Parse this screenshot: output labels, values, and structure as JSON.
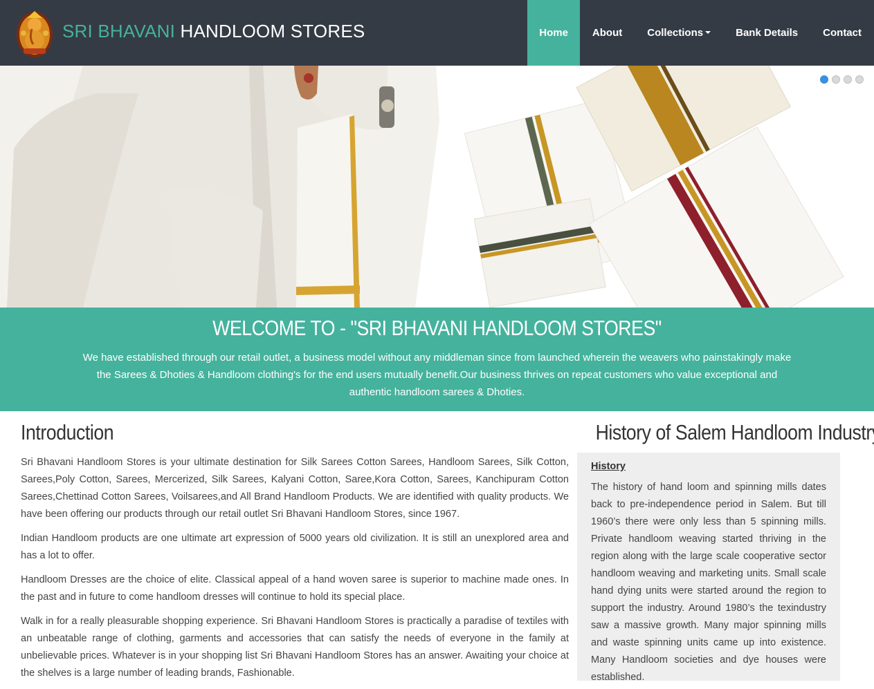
{
  "brand": {
    "part1": "SRI BHAVANI",
    "part2": "HANDLOOM STORES"
  },
  "nav": {
    "home": "Home",
    "about": "About",
    "collections": "Collections",
    "bank": "Bank Details",
    "contact": "Contact"
  },
  "colors": {
    "navbar_bg": "#353b45",
    "accent": "#45b29d",
    "active_dot": "#3a8fe0"
  },
  "carousel": {
    "slide_count": 4,
    "active_index": 0
  },
  "welcome": {
    "title": "WELCOME TO - \"SRI BHAVANI HANDLOOM STORES\"",
    "text": "We have established through our retail outlet, a business model without any middleman since from launched wherein the weavers who painstakingly make the Sarees & Dhoties & Handloom clothing's for the end users mutually benefit.Our business thrives on repeat customers who value exceptional and authentic handloom sarees & Dhoties."
  },
  "intro": {
    "heading": "Introduction",
    "paragraphs": [
      "Sri Bhavani Handloom Stores is your ultimate destination for Silk Sarees Cotton Sarees, Handloom Sarees, Silk Cotton, Sarees,Poly Cotton, Sarees, Mercerized, Silk Sarees, Kalyani Cotton, Saree,Kora Cotton, Sarees, Kanchipuram Cotton Sarees,Chettinad Cotton Sarees, Voilsarees,and All Brand Handloom Products. We are identified with quality products. We have been offering our products through our retail outlet Sri Bhavani Handloom Stores, since 1967.",
      "Indian Handloom products are one ultimate art expression of 5000 years old civilization. It is still an unexplored area and has a lot to offer.",
      "Handloom Dresses are the choice of elite. Classical appeal of a hand woven saree is superior to machine made ones. In the past and in future to come handloom dresses will continue to hold its special place.",
      "Walk in for a really pleasurable shopping experience. Sri Bhavani Handloom Stores is practically a paradise of textiles with an unbeatable range of clothing, garments and accessories that can satisfy the needs of everyone in the family at unbelievable prices. Whatever is in your shopping list Sri Bhavani Handloom Stores has an answer. Awaiting your choice at the shelves is a large number of leading brands, Fashionable."
    ]
  },
  "history": {
    "heading": "History of Salem Handloom Industry",
    "subheading": "History",
    "text": "The history of hand loom and spinning mills dates back to pre-independence period in Salem. But till 1960’s there were only less than 5 spinning mills. Private handloom weaving started thriving in the region along with the large scale cooperative sector handloom weaving and marketing units. Small scale hand dying units were started around the region to support the industry. Around 1980’s the texindustry saw a massive growth. Many major spinning mills and waste spinning units came up into existence. Many Handloom societies and dye houses were established."
  }
}
